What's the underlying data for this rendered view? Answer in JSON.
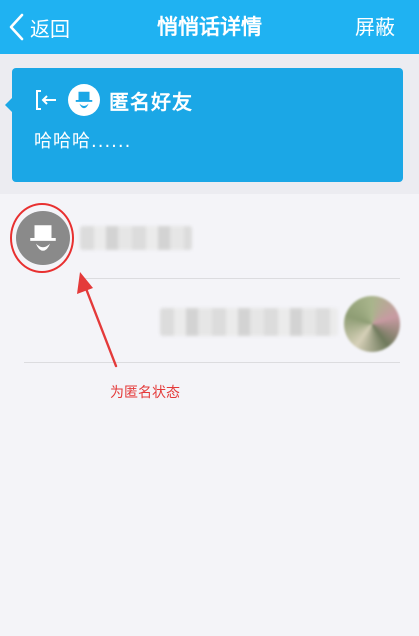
{
  "nav": {
    "back_label": "返回",
    "title": "悄悄话详情",
    "block_label": "屏蔽"
  },
  "message": {
    "sender_name": "匿名好友",
    "text": "哈哈哈......",
    "exit_icon": "exit-icon",
    "avatar_icon": "anonymous-avatar-icon"
  },
  "annotation": {
    "text": "为匿名状态",
    "color": "#e43a3a"
  },
  "colors": {
    "nav_bg": "#1fb2f2",
    "bubble_bg": "#1ba7e6",
    "page_bg": "#ececf1"
  }
}
